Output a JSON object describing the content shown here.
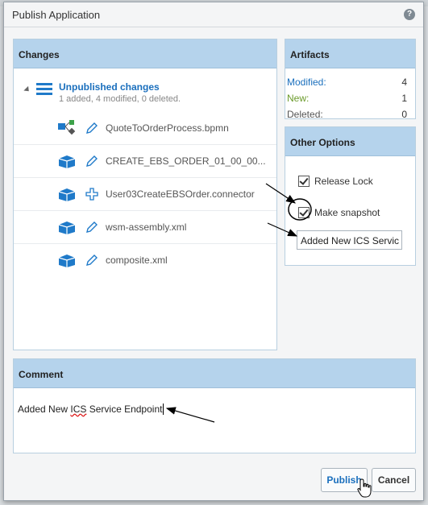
{
  "dialog": {
    "title": "Publish Application",
    "help_icon": "?"
  },
  "changes": {
    "header": "Changes",
    "root": {
      "label": "Unpublished changes",
      "summary": "1 added, 4 modified, 0 deleted."
    },
    "items": [
      {
        "name": "QuoteToOrderProcess.bpmn",
        "type_icon": "process-icon",
        "action_icon": "edit-icon"
      },
      {
        "name": "CREATE_EBS_ORDER_01_00_00...",
        "type_icon": "package-icon",
        "action_icon": "edit-icon"
      },
      {
        "name": "User03CreateEBSOrder.connector",
        "type_icon": "package-icon",
        "action_icon": "add-icon"
      },
      {
        "name": "wsm-assembly.xml",
        "type_icon": "package-icon",
        "action_icon": "edit-icon"
      },
      {
        "name": "composite.xml",
        "type_icon": "package-icon",
        "action_icon": "edit-icon"
      }
    ]
  },
  "artifacts": {
    "header": "Artifacts",
    "rows": [
      {
        "label": "Modified:",
        "value": "4",
        "color": "#1a6fbd"
      },
      {
        "label": "New:",
        "value": "1",
        "color": "#6a9a2a"
      },
      {
        "label": "Deleted:",
        "value": "0",
        "color": "#555555"
      }
    ]
  },
  "options": {
    "header": "Other Options",
    "release_lock": {
      "label": "Release Lock",
      "checked": true
    },
    "make_snapshot": {
      "label": "Make snapshot",
      "checked": true
    },
    "snapshot_value": "Added New ICS Servic"
  },
  "comment": {
    "header": "Comment",
    "value_before": "Added New ",
    "value_misspelled": "ICS",
    "value_after": " Service Endpoint"
  },
  "buttons": {
    "publish": "Publish",
    "cancel": "Cancel"
  },
  "colors": {
    "header_bg": "#b5d3ec",
    "accent": "#1a6fbd",
    "icon_blue": "#1f7ac9"
  }
}
